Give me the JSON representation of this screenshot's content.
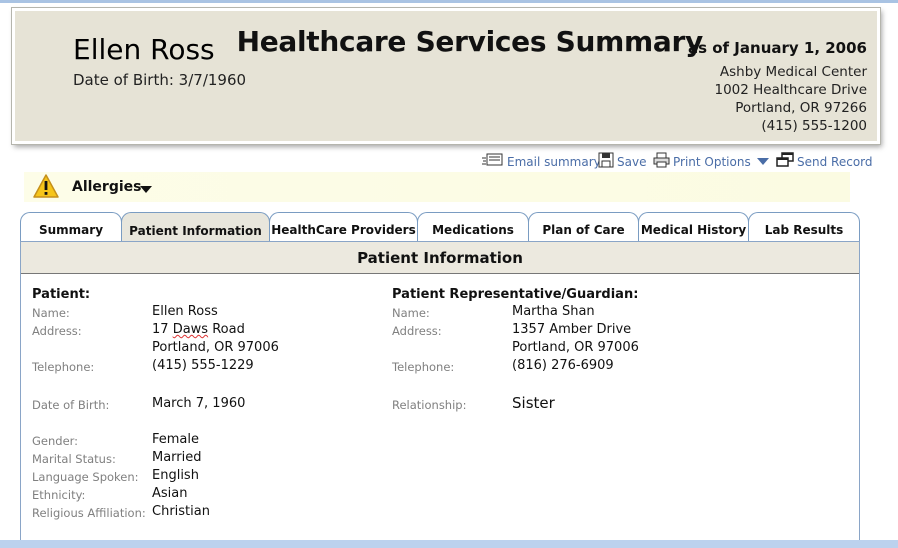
{
  "header": {
    "patient_name": "Ellen Ross",
    "dob_line": "Date of Birth: 3/7/1960",
    "title": "Healthcare Services Summary",
    "as_of": "as of January 1, 2006",
    "facility": [
      "Ashby Medical Center",
      "1002 Healthcare Drive",
      "Portland, OR  97266",
      "(415) 555-1200"
    ]
  },
  "actions": {
    "email": "Email summary",
    "save": "Save",
    "print": "Print Options",
    "send": "Send Record"
  },
  "allergies": {
    "label": "Allergies"
  },
  "tabs": [
    "Summary",
    "Patient Information",
    "HealthCare Providers",
    "Medications",
    "Plan of Care",
    "Medical History",
    "Lab Results"
  ],
  "active_tab": "Patient Information",
  "panel": {
    "title": "Patient Information",
    "patient": {
      "heading": "Patient:",
      "name_label": "Name:",
      "name": "Ellen Ross",
      "address_label": "Address:",
      "address_street_num": "17",
      "address_street_word": "Daws",
      "address_street_rest": "Road",
      "address_city": "Portland, OR  97006",
      "telephone_label": "Telephone:",
      "telephone": "(415) 555-1229",
      "dob_label": "Date of Birth:",
      "dob": "March 7, 1960",
      "gender_label": "Gender:",
      "gender": "Female",
      "marital_label": "Marital Status:",
      "marital": "Married",
      "language_label": "Language Spoken:",
      "language": "English",
      "ethnicity_label": "Ethnicity:",
      "ethnicity": "Asian",
      "religion_label": "Religious Affiliation:",
      "religion": "Christian"
    },
    "guardian": {
      "heading": "Patient Representative/Guardian:",
      "name_label": "Name:",
      "name": "Martha Shan",
      "address_label": "Address:",
      "address_street": "1357 Amber Drive",
      "address_city": "Portland, OR  97006",
      "telephone_label": "Telephone:",
      "telephone": "(816) 276-6909",
      "relationship_label": "Relationship:",
      "relationship": "Sister"
    }
  },
  "colors": {
    "link": "#4a6da7",
    "tab_border": "#7a9cc2",
    "header_bg": "#e6e3d6",
    "allergy_bg": "#fdfde8"
  }
}
